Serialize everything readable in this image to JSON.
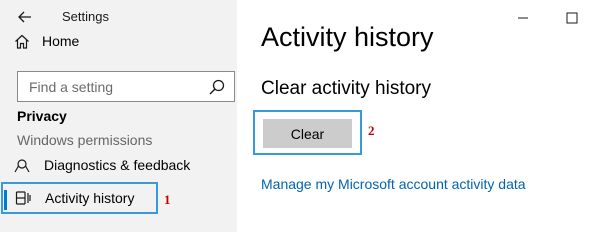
{
  "window": {
    "app_title": "Settings"
  },
  "sidebar": {
    "home_label": "Home",
    "search_placeholder": "Find a setting",
    "section_heading": "Privacy",
    "section_subheading": "Windows permissions",
    "items": [
      {
        "label": "Diagnostics & feedback",
        "icon": "diagnostics-icon"
      },
      {
        "label": "Activity history",
        "icon": "activity-history-icon",
        "selected": true
      }
    ]
  },
  "main": {
    "page_title": "Activity history",
    "clear_section_title": "Clear activity history",
    "clear_button_label": "Clear",
    "manage_link": "Manage my Microsoft account activity data"
  },
  "annotations": {
    "step_1": "1",
    "step_2": "2",
    "highlight_color": "#3a9ad9",
    "marker_color": "#c00000"
  },
  "colors": {
    "sidebar_bg": "#f2f2f2",
    "accent": "#0078d7",
    "link": "#0063b1",
    "button_bg": "#cccccc"
  }
}
